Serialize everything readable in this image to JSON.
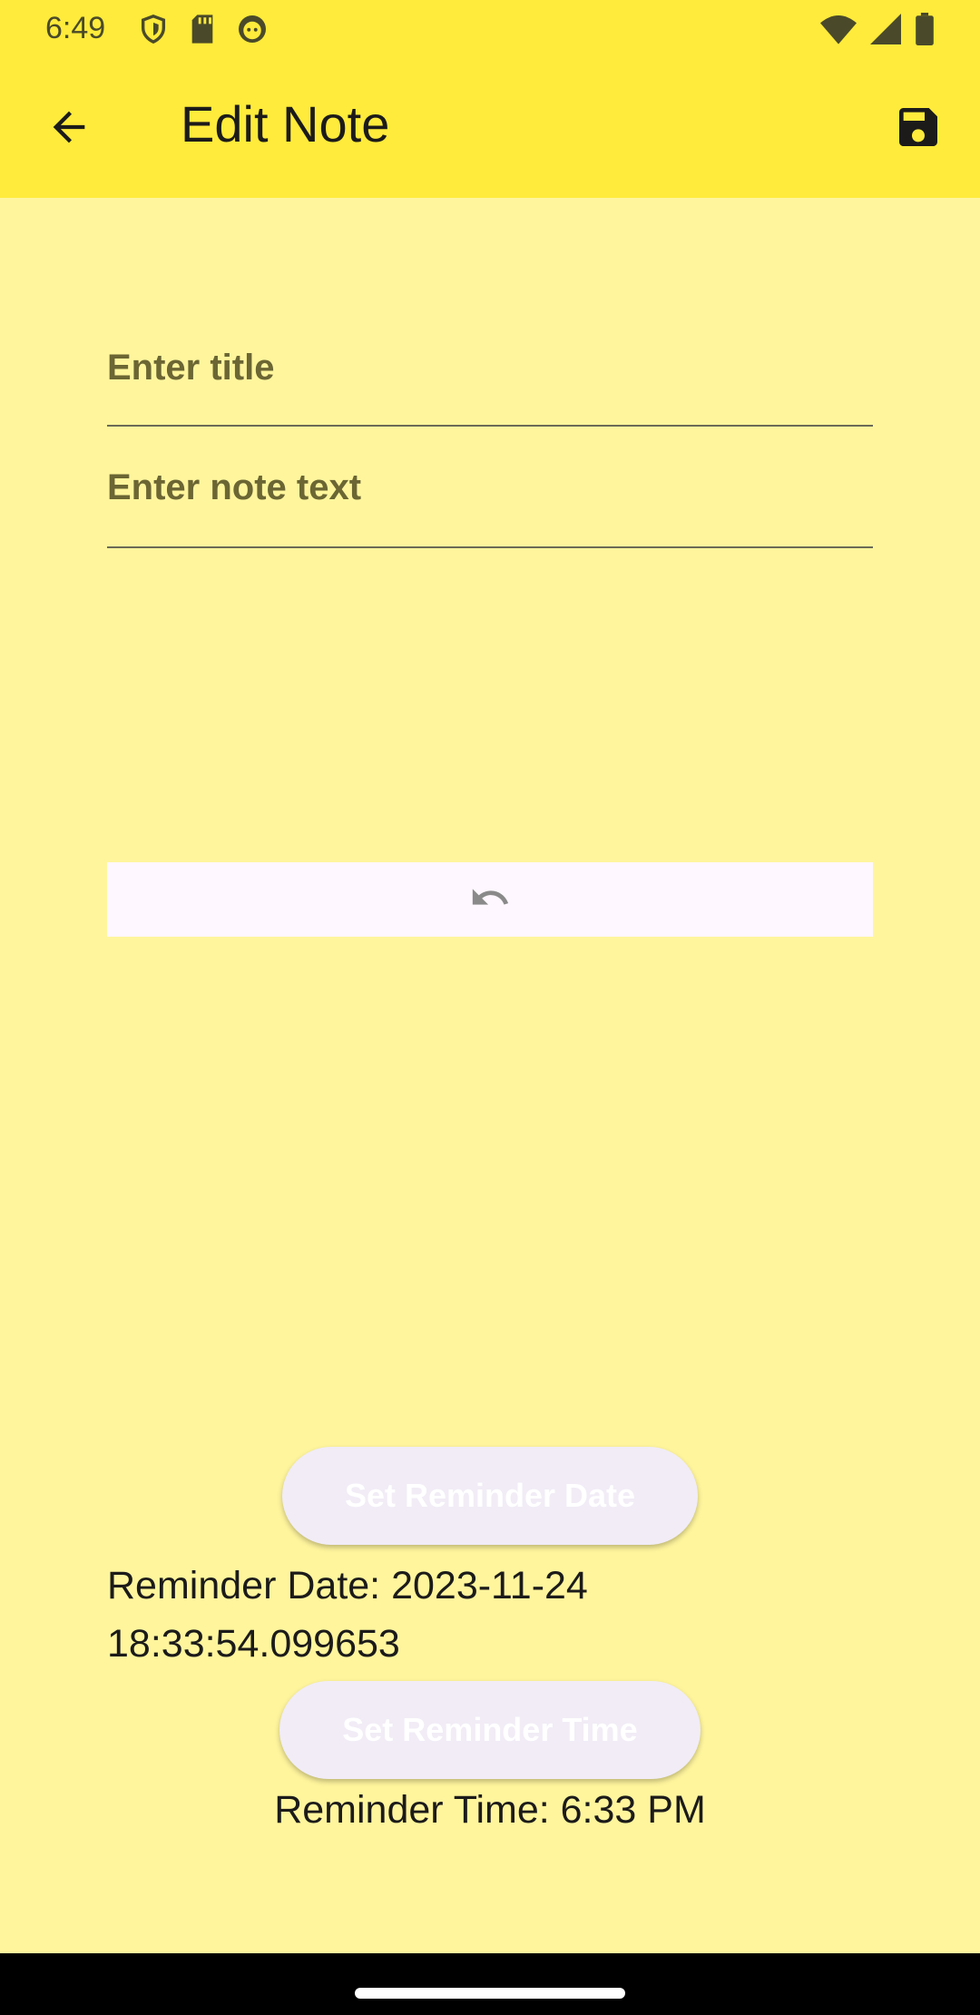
{
  "status_bar": {
    "time": "6:49",
    "icons": [
      "shield-icon",
      "sd-card-icon",
      "face-icon",
      "wifi-icon",
      "signal-icon",
      "battery-icon"
    ]
  },
  "app_bar": {
    "title": "Edit Note",
    "back_icon": "arrow-back-icon",
    "save_icon": "save-icon",
    "background": "#FFEB3B"
  },
  "form": {
    "title_placeholder": "Enter title",
    "title_value": "",
    "note_placeholder": "Enter note text",
    "note_value": ""
  },
  "editor_toolbar": {
    "undo_icon": "undo-icon"
  },
  "reminder": {
    "set_date_label": "Set Reminder Date",
    "date_text": "Reminder Date: 2023-11-24 18:33:54.099653",
    "set_time_label": "Set Reminder Time",
    "time_text": "Reminder Time: 6:33 PM"
  },
  "colors": {
    "body_background": "#FFF59D",
    "accent": "#FFEB3B"
  }
}
